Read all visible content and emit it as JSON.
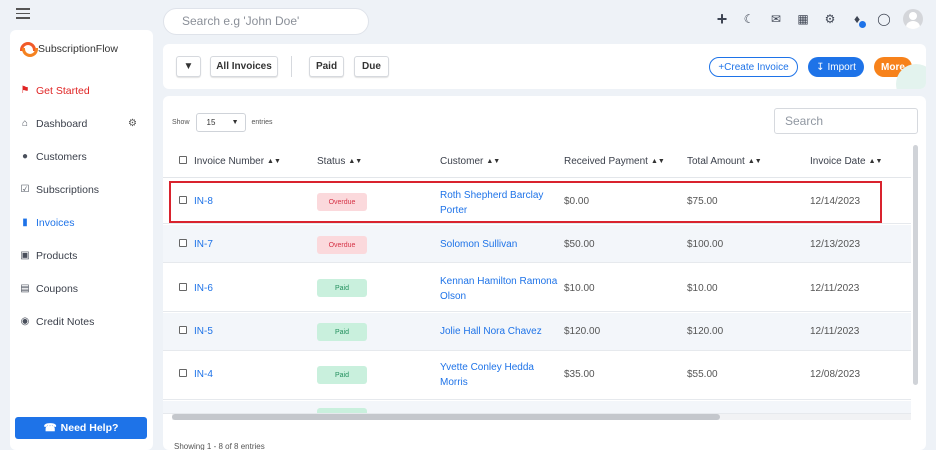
{
  "topbar": {
    "search_placeholder": "Search e.g 'John Doe'",
    "icons": [
      "plus-icon",
      "moon-icon",
      "mail-icon",
      "calendar-icon",
      "gear-icon",
      "bell-icon",
      "headset-icon",
      "user-avatar"
    ]
  },
  "sidebar": {
    "brand": "SubscriptionFlow",
    "items": [
      {
        "label": "Get Started",
        "icon": "flag-icon"
      },
      {
        "label": "Dashboard",
        "icon": "home-icon"
      },
      {
        "label": "Customers",
        "icon": "users-icon"
      },
      {
        "label": "Subscriptions",
        "icon": "checklist-icon"
      },
      {
        "label": "Invoices",
        "icon": "invoice-icon"
      },
      {
        "label": "Products",
        "icon": "box-icon"
      },
      {
        "label": "Coupons",
        "icon": "ticket-icon"
      },
      {
        "label": "Credit Notes",
        "icon": "credit-note-icon"
      }
    ],
    "help_label": "Need Help?"
  },
  "filterbar": {
    "all_invoices": "All Invoices",
    "paid": "Paid",
    "due": "Due",
    "create": "+Create Invoice",
    "import": "Import",
    "more": "More"
  },
  "table": {
    "show_label": "Show",
    "entries_value": "15",
    "entries_label": "entries",
    "search_placeholder": "Search",
    "headers": [
      "Invoice Number",
      "Status",
      "Customer",
      "Received Payment",
      "Total Amount",
      "Invoice Date"
    ],
    "rows": [
      {
        "number": "IN-8",
        "status": "Overdue",
        "customer1": "Roth Shepherd Barclay",
        "customer2": "Porter",
        "received": "$0.00",
        "total": "$75.00",
        "date": "12/14/2023"
      },
      {
        "number": "IN-7",
        "status": "Overdue",
        "customer1": "Solomon Sullivan",
        "customer2": "",
        "received": "$50.00",
        "total": "$100.00",
        "date": "12/13/2023"
      },
      {
        "number": "IN-6",
        "status": "Paid",
        "customer1": "Kennan Hamilton Ramona",
        "customer2": "Olson",
        "received": "$10.00",
        "total": "$10.00",
        "date": "12/11/2023"
      },
      {
        "number": "IN-5",
        "status": "Paid",
        "customer1": "Jolie Hall Nora Chavez",
        "customer2": "",
        "received": "$120.00",
        "total": "$120.00",
        "date": "12/11/2023"
      },
      {
        "number": "IN-4",
        "status": "Paid",
        "customer1": "Yvette Conley Hedda",
        "customer2": "Morris",
        "received": "$35.00",
        "total": "$55.00",
        "date": "12/08/2023"
      }
    ],
    "footer": "Showing 1 - 8 of 8 entries"
  },
  "colors": {
    "accent": "#1e73e8",
    "overdue_bg": "#fbd9dc",
    "paid_bg": "#c9f0dd",
    "more": "#f7821b",
    "highlight": "#d9232e"
  }
}
